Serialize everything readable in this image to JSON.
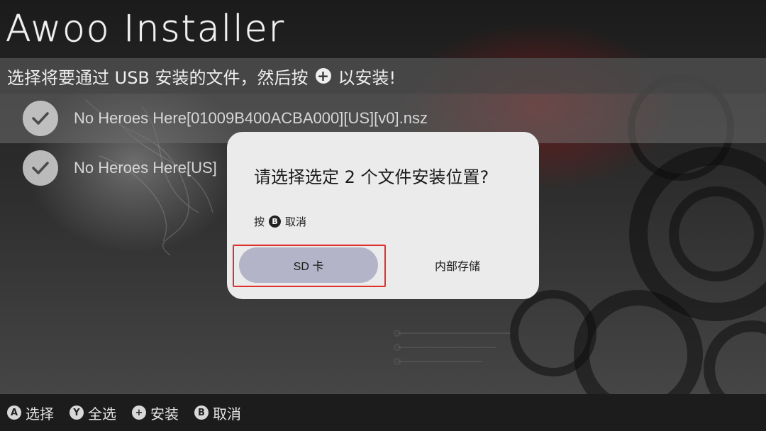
{
  "app": {
    "title": "Awoo Installer"
  },
  "hint": {
    "prefix": "选择将要通过 USB 安装的文件，然后按",
    "plus_glyph": "+",
    "suffix": "以安装!"
  },
  "files": [
    {
      "name": "No Heroes Here[01009B400ACBA000][US][v0].nsz",
      "selected": true,
      "icon": "check-icon"
    },
    {
      "name": "No Heroes Here[US]",
      "selected": true,
      "icon": "check-icon"
    }
  ],
  "dialog": {
    "title": "请选择选定 2 个文件安装位置?",
    "cancel_prefix": "按",
    "cancel_glyph": "B",
    "cancel_suffix": "取消",
    "options": [
      {
        "label": "SD 卡",
        "focused": true
      },
      {
        "label": "内部存储",
        "focused": false
      }
    ]
  },
  "footer": [
    {
      "glyph": "A",
      "label": "选择"
    },
    {
      "glyph": "Y",
      "label": "全选"
    },
    {
      "glyph": "+",
      "label": "安装"
    },
    {
      "glyph": "B",
      "label": "取消"
    }
  ],
  "colors": {
    "highlight_border": "#e0302c",
    "focused_button": "#b4b4c8",
    "dialog_bg": "#ebebeb"
  }
}
